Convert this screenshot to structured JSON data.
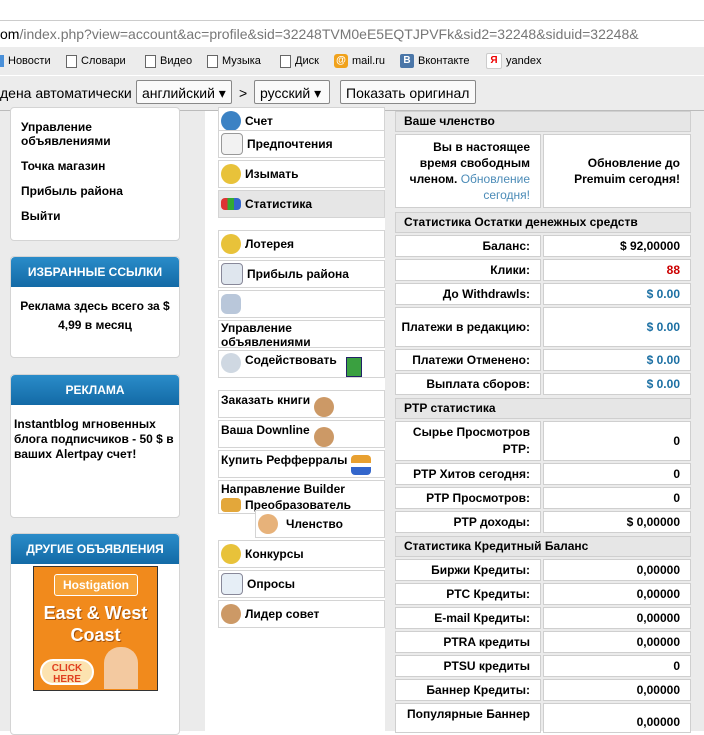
{
  "browser": {
    "url_domain": "om",
    "url_path": "/index.php?view=account&ac=profile&sid=32248TVM0eE5EQTJPVFk&sid2=32248&siduid=32248&",
    "bookmarks": [
      "Новости",
      "Словари",
      "Видео",
      "Музыка",
      "Диск",
      "mail.ru",
      "Вконтакте",
      "yandex"
    ]
  },
  "translate": {
    "detected_text": "дена автоматически",
    "from_lang": "английский",
    "arrow": ">",
    "to_lang": "русский",
    "show_original": "Показать оригинал"
  },
  "left_menu": [
    "Управление объявлениями",
    "Точка магазин",
    "Прибыль района",
    "Выйти"
  ],
  "favorites": {
    "title": "ИЗБРАННЫЕ ССЫЛКИ",
    "text": "Реклама здесь всего за $ 4,99 в месяц"
  },
  "ads": {
    "title": "РЕКЛАМА",
    "text": "Instantblog мгновенных блога подписчиков - 50 $ в ваших Alertpay счет!"
  },
  "other_ads": {
    "title": "ДРУГИЕ ОБЪЯВЛЕНИЯ",
    "banner_brand": "Hostigation",
    "banner_line1": "East & West",
    "banner_line2": "Coast",
    "banner_cta": "CLICK HERE"
  },
  "mid_menu": {
    "account": "Счет",
    "prefs": "Предпочтения",
    "withdraw": "Изымать",
    "stats": "Статистика",
    "lottery": "Лотерея",
    "area_profit": "Прибыль района",
    "manage_ads": "Управление объявлениями",
    "assist": "Содействовать",
    "order_books": "Заказать книги",
    "downline": "Ваша Downline",
    "buy_refs": "Купить Рефферралы",
    "builder": "Направление Builder",
    "converter": "Преобразователь",
    "membership": "Членство",
    "contests": "Конкурсы",
    "polls": "Опросы",
    "leader": "Лидер совет"
  },
  "membership": {
    "title": "Ваше членство",
    "current_prefix": "Вы в настоящее время свободным членом.",
    "update_link": "Обновление сегодня!",
    "upgrade": "Обновление до Premuim сегодня!"
  },
  "cash_stats": {
    "title": "Статистика Остатки денежных средств",
    "rows": [
      {
        "label": "Баланс:",
        "value": "$ 92,00000"
      },
      {
        "label": "Клики:",
        "value": "88"
      },
      {
        "label": "До Withdrawls:",
        "value": "$ 0.00"
      },
      {
        "label": "Платежи в редакцию:",
        "value": "$ 0.00"
      },
      {
        "label": "Платежи Отменено:",
        "value": "$ 0.00"
      },
      {
        "label": "Выплата сборов:",
        "value": "$ 0.00"
      }
    ]
  },
  "ptp_stats": {
    "title": "PTP статистика",
    "rows": [
      {
        "label": "Сырье Просмотров PTP:",
        "value": "0"
      },
      {
        "label": "PTP Хитов сегодня:",
        "value": "0"
      },
      {
        "label": "PTP Просмотров:",
        "value": "0"
      },
      {
        "label": "PTP доходы:",
        "value": "$ 0,00000"
      }
    ]
  },
  "credit_stats": {
    "title": "Статистика Кредитный Баланс",
    "rows": [
      {
        "label": "Биржи Кредиты:",
        "value": "0,00000"
      },
      {
        "label": "PTC Кредиты:",
        "value": "0,00000"
      },
      {
        "label": "E-mail Кредиты:",
        "value": "0,00000"
      },
      {
        "label": "PTRA кредиты",
        "value": "0,00000"
      },
      {
        "label": "PTSU кредиты",
        "value": "0"
      },
      {
        "label": "Баннер Кредиты:",
        "value": "0,00000"
      },
      {
        "label": "Популярные Баннер",
        "value": "0,00000"
      }
    ]
  }
}
